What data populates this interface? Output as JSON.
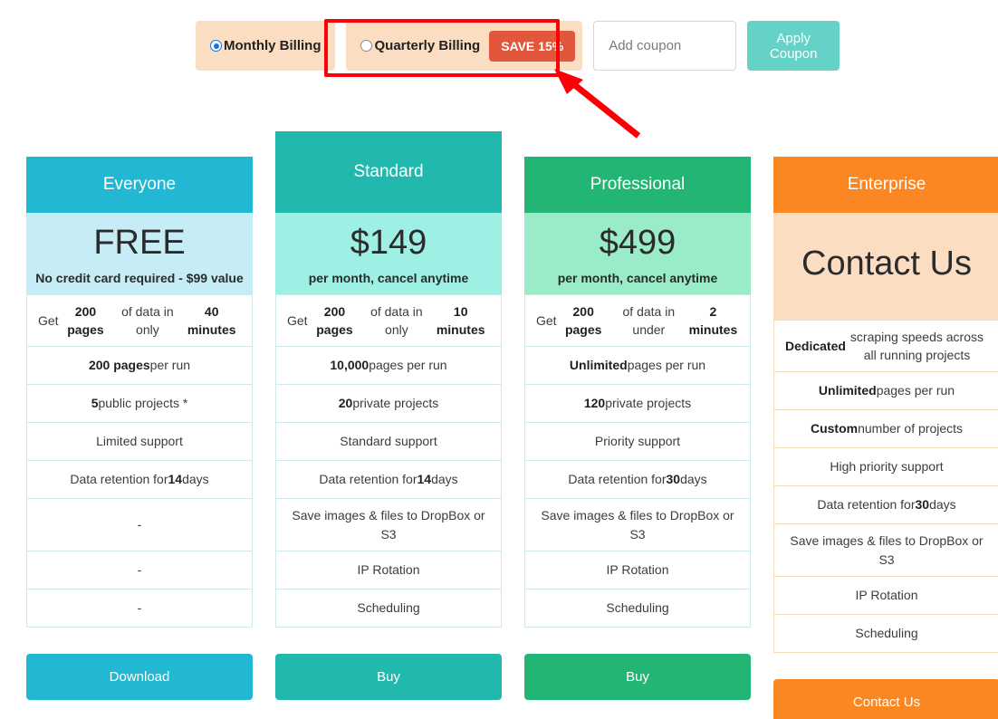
{
  "billing": {
    "monthly_label": "Monthly Billing",
    "monthly_selected": true,
    "quarterly_label": "Quarterly Billing",
    "quarterly_selected": false,
    "save_badge": "SAVE 15%",
    "coupon_placeholder": "Add coupon",
    "coupon_value": "",
    "apply_label": "Apply Coupon",
    "colors": {
      "option_bg": "#fbdec1",
      "save_badge_bg": "#e2573c",
      "apply_bg": "#64d2c7",
      "radio_accent": "#1273e6"
    }
  },
  "annotation": {
    "box_color": "#fb0007",
    "arrow_color": "#fb0007",
    "target": "quarterly-billing-option"
  },
  "plans": [
    {
      "name": "Everyone",
      "price": "FREE",
      "price_note": "No credit card required - $99 value",
      "header_color": "#22b7d2",
      "price_bg": "#c6ecf5",
      "border_color": "#cfe9ea",
      "cta_label": "Download",
      "cta_color": "#22b7d2",
      "features": [
        "Get <b>200 pages</b> of data in only <b>40 minutes</b>",
        "<b>200 pages</b> per run",
        "<b>5</b> public projects *",
        "Limited support",
        "Data retention for <b>14</b> days",
        "-",
        "-",
        "-"
      ]
    },
    {
      "name": "Standard",
      "price": "$149",
      "price_note": "per month, cancel anytime",
      "header_color": "#21b9ad",
      "price_bg": "#9eefe4",
      "border_color": "#cfe9ea",
      "cta_label": "Buy",
      "cta_color": "#21b9ad",
      "features": [
        "Get <b>200 pages</b> of data in only <b>10 minutes</b>",
        "<b>10,000</b> pages per run",
        "<b>20</b> private projects",
        "Standard support",
        "Data retention for <b>14</b> days",
        "Save images &amp; files to DropBox or S3",
        "IP Rotation",
        "Scheduling"
      ]
    },
    {
      "name": "Professional",
      "price": "$499",
      "price_note": "per month, cancel anytime",
      "header_color": "#22b573",
      "price_bg": "#9aebc7",
      "border_color": "#cfe9ea",
      "cta_label": "Buy",
      "cta_color": "#22b573",
      "features": [
        "Get <b>200 pages</b> of data in under <b>2 minutes</b>",
        "<b>Unlimited</b> pages per run",
        "<b>120</b> private projects",
        "Priority support",
        "Data retention for <b>30</b> days",
        "Save images &amp; files to DropBox or S3",
        "IP Rotation",
        "Scheduling"
      ]
    },
    {
      "name": "Enterprise",
      "price": "Contact Us",
      "price_note": "",
      "header_color": "#fa8722",
      "price_bg": "#fbdec1",
      "border_color": "#f7dbbd",
      "cta_label": "Contact Us",
      "cta_color": "#fa8722",
      "features": [
        "<b>Dedicated</b> scraping speeds across all running projects",
        "<b>Unlimited</b> pages per run",
        "<b>Custom</b> number of projects",
        "High priority support",
        "Data retention for <b>30</b> days",
        "Save images &amp; files to DropBox or S3",
        "IP Rotation",
        "Scheduling"
      ]
    }
  ]
}
